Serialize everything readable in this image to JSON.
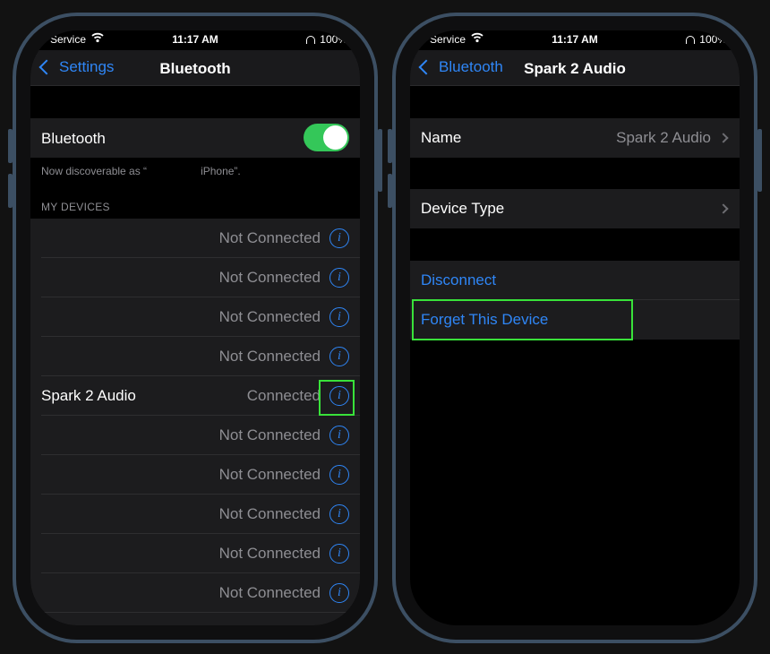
{
  "left_screen": {
    "status": {
      "carrier": "Service",
      "time": "11:17 AM",
      "battery": "100%"
    },
    "nav": {
      "back_label": "Settings",
      "title": "Bluetooth"
    },
    "bluetooth_row": {
      "label": "Bluetooth",
      "toggle_on": true
    },
    "discoverable_prefix": "Now discoverable as “",
    "discoverable_suffix": "iPhone”.",
    "section_header": "MY DEVICES",
    "devices": [
      {
        "name": "",
        "status": "Not Connected"
      },
      {
        "name": "",
        "status": "Not Connected"
      },
      {
        "name": "",
        "status": "Not Connected"
      },
      {
        "name": "",
        "status": "Not Connected"
      },
      {
        "name": "Spark 2 Audio",
        "status": "Connected",
        "highlighted": true
      },
      {
        "name": "",
        "status": "Not Connected"
      },
      {
        "name": "",
        "status": "Not Connected"
      },
      {
        "name": "",
        "status": "Not Connected"
      },
      {
        "name": "",
        "status": "Not Connected"
      },
      {
        "name": "",
        "status": "Not Connected"
      }
    ]
  },
  "right_screen": {
    "status": {
      "carrier": "Service",
      "time": "11:17 AM",
      "battery": "100%"
    },
    "nav": {
      "back_label": "Bluetooth",
      "title": "Spark 2 Audio"
    },
    "name_row": {
      "label": "Name",
      "value": "Spark 2 Audio"
    },
    "device_type_row": {
      "label": "Device Type"
    },
    "disconnect_label": "Disconnect",
    "forget_label": "Forget This Device"
  },
  "colors": {
    "accent": "#2f86f6",
    "toggle_on": "#34c759",
    "highlight": "#39e23a",
    "frame": "#3c4f63"
  },
  "icons": [
    "wifi-icon",
    "headphones-icon",
    "battery-icon",
    "chevron-left-icon",
    "chevron-right-icon",
    "info-icon"
  ]
}
